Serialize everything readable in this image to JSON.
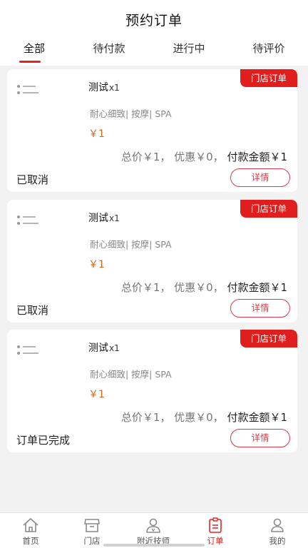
{
  "header": {
    "title": "预约订单"
  },
  "tabs": [
    {
      "label": "全部",
      "active": true
    },
    {
      "label": "待付款",
      "active": false
    },
    {
      "label": "进行中",
      "active": false
    },
    {
      "label": "待评价",
      "active": false
    }
  ],
  "orders": [
    {
      "badge": "门店订单",
      "service_name": "测试",
      "quantity": "x1",
      "tags": "耐心细致| 按摩| SPA",
      "price": "￥1",
      "summary_prefix": "总价￥1， 优惠￥0， ",
      "summary_pay": "付款金额￥1",
      "status": "已取消",
      "detail_label": "详情"
    },
    {
      "badge": "门店订单",
      "service_name": "测试",
      "quantity": "x1",
      "tags": "耐心细致| 按摩| SPA",
      "price": "￥1",
      "summary_prefix": "总价￥1， 优惠￥0， ",
      "summary_pay": "付款金额￥1",
      "status": "已取消",
      "detail_label": "详情"
    },
    {
      "badge": "门店订单",
      "service_name": "测试",
      "quantity": "x1",
      "tags": "耐心细致| 按摩| SPA",
      "price": "￥1",
      "summary_prefix": "总价￥1， 优惠￥0， ",
      "summary_pay": "付款金额￥1",
      "status": "订单已完成",
      "detail_label": "详情"
    }
  ],
  "tabbar": [
    {
      "label": "首页",
      "icon": "home-icon",
      "active": false
    },
    {
      "label": "门店",
      "icon": "store-icon",
      "active": false
    },
    {
      "label": "附近技师",
      "icon": "technician-icon",
      "active": false
    },
    {
      "label": "订单",
      "icon": "order-icon",
      "active": true
    },
    {
      "label": "我的",
      "icon": "profile-icon",
      "active": false
    }
  ],
  "colors": {
    "accent": "#e52222",
    "badge": "#e01e1e",
    "price": "#d2691e",
    "detail_border": "#d9394a"
  }
}
